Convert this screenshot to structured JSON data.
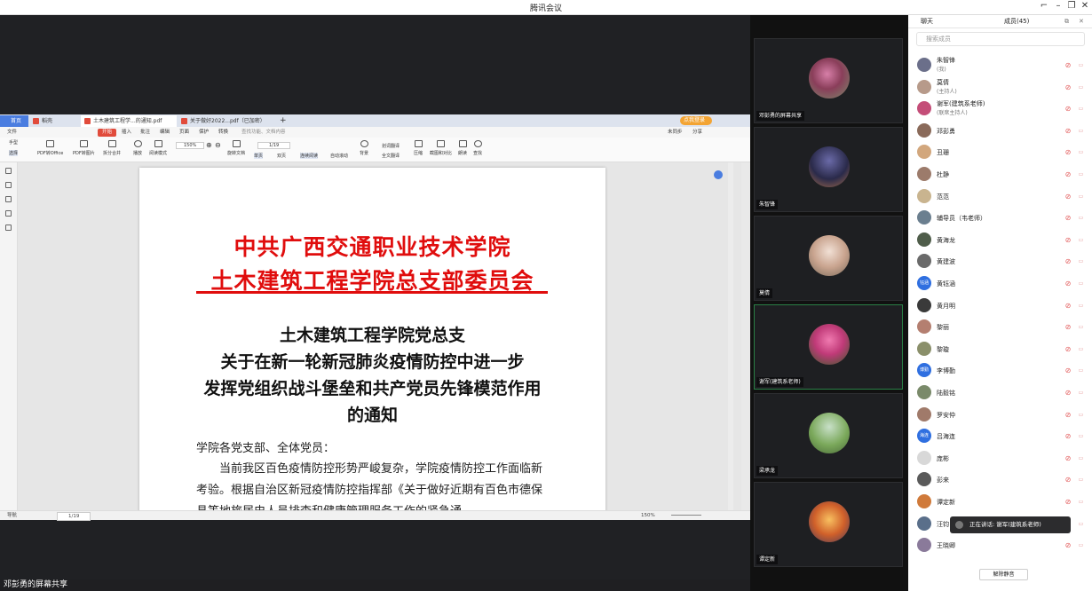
{
  "window": {
    "title": "腾讯会议"
  },
  "wps": {
    "tabs": [
      "首页",
      "稻壳",
      "土木建筑工程学...的通知.pdf",
      "关于做好2022...pdf（已加密）"
    ],
    "menu": {
      "file": "文件",
      "start": "开始",
      "insert": "插入",
      "annotate": "批注",
      "edit": "编辑",
      "page": "页面",
      "protect": "保护",
      "convert": "转换",
      "search": "查找功能、文档内容",
      "sync": "未同步",
      "share": "分享"
    },
    "ribbon": {
      "hand": "手型",
      "select": "选择",
      "pdf2office": "PDF转Office",
      "pdf2img": "PDF转图片",
      "split": "拆分合并",
      "play": "播放",
      "read": "阅读模式",
      "zoom": "150%",
      "page_nav": "1/19",
      "rotate": "旋转文档",
      "single": "单页",
      "double": "双页",
      "continuous": "连续阅读",
      "autoscroll": "自动滚动",
      "bg": "背景",
      "translate_sel": "划词翻译",
      "translate_all": "全文翻译",
      "compress": "压缩",
      "crop": "截图和对比",
      "read_aloud": "朗读",
      "find": "查找",
      "login": "点我登录"
    },
    "doc": {
      "header1": "中共广西交通职业技术学院",
      "header2": "土木建筑工程学院总支部委员会",
      "title1": "土木建筑工程学院党总支",
      "title2": "关于在新一轮新冠肺炎疫情防控中进一步",
      "title3": "发挥党组织战斗堡垒和共产党员先锋模范作用",
      "title4": "的通知",
      "salutation": "学院各党支部、全体党员：",
      "para1": "当前我区百色疫情防控形势严峻复杂，学院疫情防控工作面临新考验。根据自治区新冠疫情防控指挥部《关于做好近期有百色市德保县等地旅居史人员排查和健康管理服务工作的紧急通"
    },
    "status": {
      "nav": "导航",
      "page": "1/19",
      "zoom": "150%"
    }
  },
  "share_label": "邓彭勇的屏幕共享",
  "video_tiles": [
    {
      "name": "邓彭勇的屏幕共享"
    },
    {
      "name": "朱智锋"
    },
    {
      "name": "莫倩"
    },
    {
      "name": "谢军(建筑系老师)"
    },
    {
      "name": "梁承龙"
    },
    {
      "name": "谭定新"
    }
  ],
  "members_panel": {
    "chat_tab": "聊天",
    "members_tab": "成员(45)",
    "search_placeholder": "搜索成员",
    "members": [
      {
        "name": "朱智锋",
        "role": "(我)",
        "avatar_text": "",
        "color": "#6b6f8a"
      },
      {
        "name": "莫倩",
        "role": "(主持人)",
        "avatar_text": "",
        "color": "#b79a8a"
      },
      {
        "name": "谢军(建筑系老师)",
        "role": "(联席主持人)",
        "avatar_text": "",
        "color": "#c44d78"
      },
      {
        "name": "邓彭勇",
        "role": "",
        "avatar_text": "",
        "color": "#8a6a5a"
      },
      {
        "name": "丑珊",
        "role": "",
        "avatar_text": "",
        "color": "#d2a77d"
      },
      {
        "name": "杜静",
        "role": "",
        "avatar_text": "",
        "color": "#9c7b6b"
      },
      {
        "name": "范范",
        "role": "",
        "avatar_text": "",
        "color": "#c9b48f"
      },
      {
        "name": "辅导员（韦老师）",
        "role": "",
        "avatar_text": "",
        "color": "#6b7f8f"
      },
      {
        "name": "黄海龙",
        "role": "",
        "avatar_text": "",
        "color": "#4f5d4a"
      },
      {
        "name": "黄建波",
        "role": "",
        "avatar_text": "",
        "color": "#6a6a6a"
      },
      {
        "name": "黄钰涵",
        "role": "",
        "avatar_text": "钰涵",
        "color": "#2f6fe0"
      },
      {
        "name": "黄月明",
        "role": "",
        "avatar_text": "",
        "color": "#3a3a3a"
      },
      {
        "name": "黎丽",
        "role": "",
        "avatar_text": "",
        "color": "#b47f70"
      },
      {
        "name": "黎璇",
        "role": "",
        "avatar_text": "",
        "color": "#8a8f6a"
      },
      {
        "name": "李博勤",
        "role": "",
        "avatar_text": "博勤",
        "color": "#2f6fe0"
      },
      {
        "name": "陆毅铭",
        "role": "",
        "avatar_text": "",
        "color": "#7a8a6a"
      },
      {
        "name": "罗安仲",
        "role": "",
        "avatar_text": "",
        "color": "#a07a6a"
      },
      {
        "name": "吕海连",
        "role": "",
        "avatar_text": "海连",
        "color": "#2f6fe0"
      },
      {
        "name": "庞彬",
        "role": "",
        "avatar_text": "",
        "color": "#d8d8d8"
      },
      {
        "name": "彭来",
        "role": "",
        "avatar_text": "",
        "color": "#5a5a5a"
      },
      {
        "name": "谭定新",
        "role": "",
        "avatar_text": "",
        "color": "#d07a3a"
      },
      {
        "name": "汪钧",
        "role": "",
        "avatar_text": "",
        "color": "#5a6f8a"
      },
      {
        "name": "王晓卿",
        "role": "",
        "avatar_text": "",
        "color": "#8a7a9a"
      }
    ],
    "speaking": "正在讲话: 谢军(建筑系老师)",
    "unmute_button": "解除静音"
  }
}
